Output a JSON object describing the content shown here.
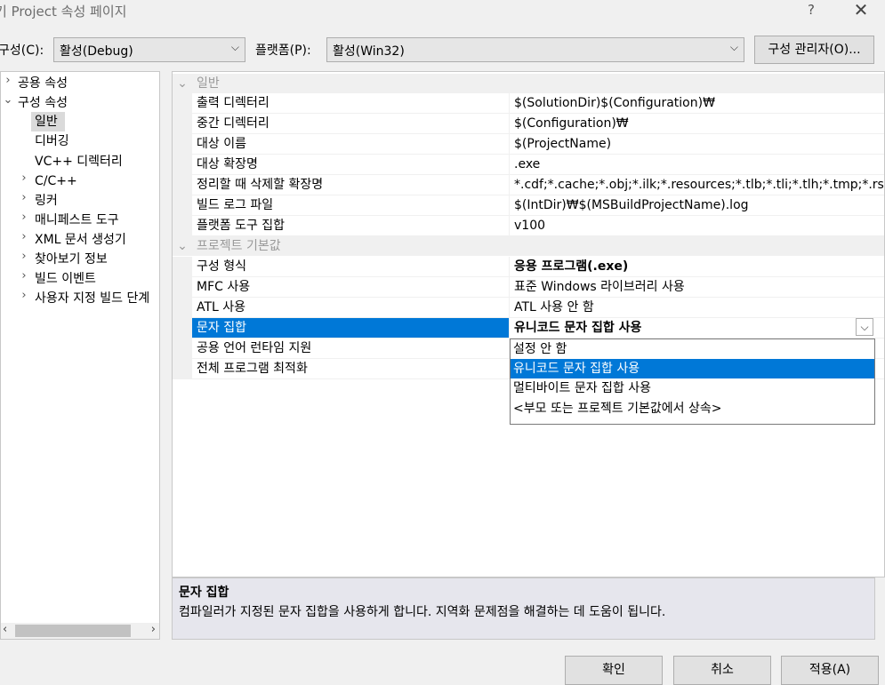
{
  "window": {
    "title": "기 Project 속성 페이지",
    "help": "?",
    "close": "✕"
  },
  "toolbar": {
    "config_label": "구성(C):",
    "config_value": "활성(Debug)",
    "platform_label": "플랫폼(P):",
    "platform_value": "활성(Win32)",
    "config_manager": "구성 관리자(O)..."
  },
  "tree": {
    "items": [
      {
        "label": "공용 속성",
        "chevron": "›"
      },
      {
        "label": "구성 속성",
        "chevron": "⌄"
      },
      {
        "label": "일반"
      },
      {
        "label": "디버깅"
      },
      {
        "label": "VC++ 디렉터리"
      },
      {
        "label": "C/C++",
        "chevron": "›"
      },
      {
        "label": "링커",
        "chevron": "›"
      },
      {
        "label": "매니페스트 도구",
        "chevron": "›"
      },
      {
        "label": "XML 문서 생성기",
        "chevron": "›"
      },
      {
        "label": "찾아보기 정보",
        "chevron": "›"
      },
      {
        "label": "빌드 이벤트",
        "chevron": "›"
      },
      {
        "label": "사용자 지정 빌드 단계",
        "chevron": "›"
      }
    ]
  },
  "grid": {
    "categories": [
      {
        "name": "일반",
        "chevron": "⌄"
      },
      {
        "name": "프로젝트 기본값",
        "chevron": "⌄"
      }
    ],
    "general_rows": [
      {
        "name": "출력 디렉터리",
        "value": "$(SolutionDir)$(Configuration)₩"
      },
      {
        "name": "중간 디렉터리",
        "value": "$(Configuration)₩"
      },
      {
        "name": "대상 이름",
        "value": "$(ProjectName)"
      },
      {
        "name": "대상 확장명",
        "value": ".exe"
      },
      {
        "name": "정리할 때 삭제할 확장명",
        "value": "*.cdf;*.cache;*.obj;*.ilk;*.resources;*.tlb;*.tli;*.tlh;*.tmp;*.rsp;*.pgc"
      },
      {
        "name": "빌드 로그 파일",
        "value": "$(IntDir)₩$(MSBuildProjectName).log"
      },
      {
        "name": "플랫폼 도구 집합",
        "value": "v100"
      }
    ],
    "defaults_rows": [
      {
        "name": "구성 형식",
        "value": "응용 프로그램(.exe)"
      },
      {
        "name": "MFC 사용",
        "value": "표준 Windows 라이브러리 사용"
      },
      {
        "name": "ATL 사용",
        "value": "ATL 사용 안 함"
      },
      {
        "name": "문자 집합",
        "value": "유니코드 문자 집합 사용"
      },
      {
        "name": "공용 언어 런타임 지원",
        "value": ""
      },
      {
        "name": "전체 프로그램 최적화",
        "value": ""
      }
    ]
  },
  "dropdown": {
    "options": [
      "설정 안 함",
      "유니코드 문자 집합 사용",
      "멀티바이트 문자 집합 사용",
      "<부모 또는 프로젝트 기본값에서 상속>"
    ],
    "selected": "유니코드 문자 집합 사용"
  },
  "description": {
    "title": "문자 집합",
    "text": "컴파일러가 지정된 문자 집합을 사용하게 합니다. 지역화 문제점을 해결하는 데 도움이 됩니다."
  },
  "buttons": {
    "ok": "확인",
    "cancel": "취소",
    "apply": "적용(A)"
  }
}
